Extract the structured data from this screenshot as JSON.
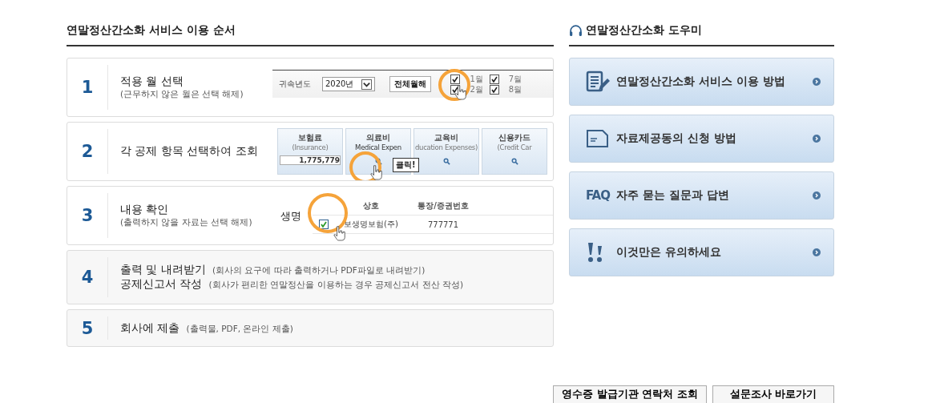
{
  "section_title": "연말정산간소화 서비스 이용 순서",
  "steps": [
    {
      "number": "1",
      "kind": "months",
      "lines": [
        {
          "title": "적용 월 선택",
          "note": "(근무하지 않은 월은 선택 해제)"
        }
      ],
      "illustration": {
        "year_label": "귀속년도",
        "year": "2020년",
        "clear_button": "전체월해",
        "months": [
          {
            "label": "1월",
            "checked": true
          },
          {
            "label": "2월",
            "checked": true
          },
          {
            "label": "7월",
            "checked": true
          },
          {
            "label": "8월",
            "checked": true
          }
        ]
      }
    },
    {
      "number": "2",
      "kind": "categories",
      "lines": [
        {
          "title": "각 공제 항목 선택하여 조회"
        }
      ],
      "illustration": {
        "tooltip": "클릭!",
        "cards": [
          {
            "label": "보험료",
            "sub": "(Insurance)",
            "amount": "1,775,779",
            "highlighted": false
          },
          {
            "label": "의료비",
            "sub": "Medical Expen",
            "highlighted": true
          },
          {
            "label": "교육비",
            "sub": "ducation Expenses)",
            "highlighted": false
          },
          {
            "label": "신용카드",
            "sub": "(Credit Car",
            "highlighted": false
          }
        ]
      }
    },
    {
      "number": "3",
      "kind": "table",
      "lines": [
        {
          "title": "내용 확인",
          "note": "(출력하지 않을 자료는 선택 해제)"
        }
      ],
      "illustration": {
        "columns": [
          "상호",
          "통장/증권번호"
        ],
        "lens_text": "생명",
        "rows": [
          {
            "checked": true,
            "name": "보생명보험(주)",
            "account": "777771"
          }
        ]
      }
    },
    {
      "number": "4",
      "kind": "text",
      "lines": [
        {
          "title": "출력 및 내려받기",
          "note": "(회사의 요구에 따라 출력하거나 PDF파일로 내려받기)"
        },
        {
          "title": "공제신고서 작성",
          "note": "(회사가 편리한 연말정산을 이용하는 경우 공제신고서 전산 작성)"
        }
      ]
    },
    {
      "number": "5",
      "kind": "text",
      "lines": [
        {
          "title": "회사에 제출",
          "note": "(출력물, PDF, 온라인 제출)"
        }
      ]
    }
  ],
  "helper_title": "연말정산간소화 도우미",
  "helper_items": [
    {
      "kind": "document",
      "label": "연말정산간소화 서비스 이용 방법"
    },
    {
      "kind": "form",
      "label": "자료제공동의 신청 방법"
    },
    {
      "kind": "faq",
      "icon_text": "FAQ",
      "label": "자주 묻는 질문과 답변"
    },
    {
      "kind": "warning",
      "label": "이것만은 유의하세요"
    }
  ],
  "buttons": [
    "영수증 발급기관 연락처 조회",
    "설문조사 바로가기"
  ]
}
